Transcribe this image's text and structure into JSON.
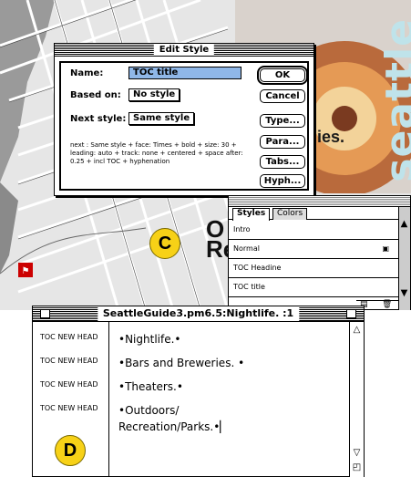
{
  "photo": {
    "caption": "ies.",
    "vertical_word": "seattle"
  },
  "callouts": {
    "c": "C",
    "d": "D",
    "c_letters_top": "O",
    "c_letters_bottom": "Re"
  },
  "dialog": {
    "title": "Edit Style",
    "name_label": "Name:",
    "name_value": "TOC title",
    "based_on_label": "Based on:",
    "based_on_value": "No style",
    "next_style_label": "Next style:",
    "next_style_value": "Same style",
    "description": "next : Same style + face: Times + bold + size: 30 + leading: auto + track: none + centered + space after: 0.25 + incl TOC + hyphenation",
    "buttons": {
      "ok": "OK",
      "cancel": "Cancel",
      "type": "Type...",
      "para": "Para...",
      "tabs": "Tabs...",
      "hyph": "Hyph..."
    }
  },
  "styles_palette": {
    "tabs": [
      "Styles",
      "Colors"
    ],
    "items": [
      "Intro",
      "Normal",
      "TOC Headine",
      "TOC title"
    ]
  },
  "document": {
    "title": "SeattleGuide3.pm6.5:Nightlife. :1",
    "side_labels": [
      "TOC NEW HEAD",
      "TOC NEW HEAD",
      "TOC NEW HEAD",
      "TOC NEW HEAD"
    ],
    "lines": [
      "•Nightlife.•",
      "•Bars and Breweries. •",
      "•Theaters.•",
      "•Outdoors/",
      "Recreation/Parks.•"
    ]
  },
  "colors": {
    "badge": "#f7d117",
    "selection": "#8fb7e8",
    "seattle": "#bfe3ea"
  }
}
